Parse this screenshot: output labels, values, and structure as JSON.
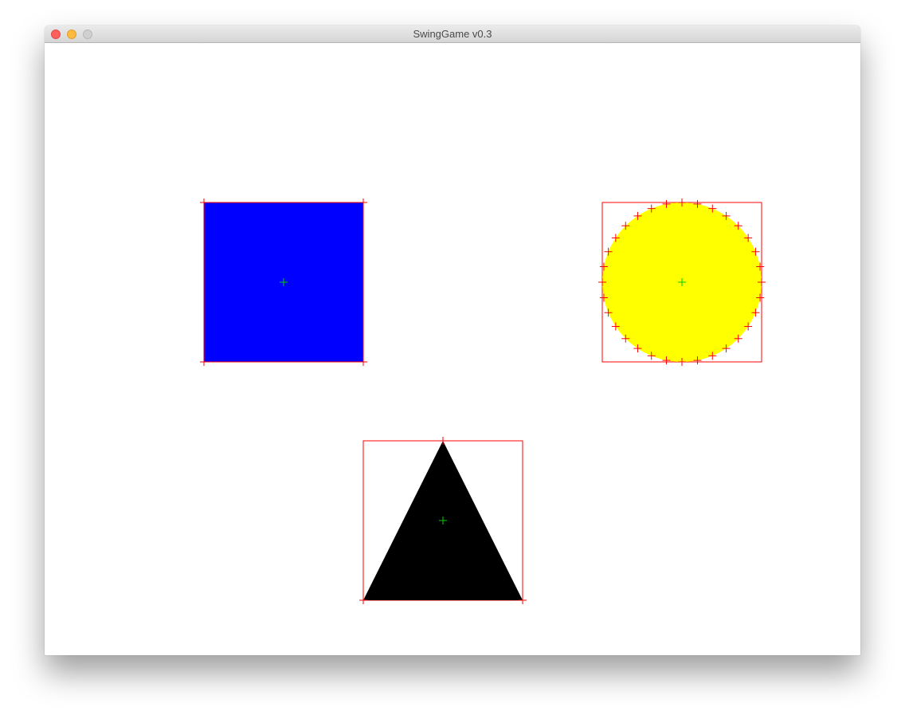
{
  "window": {
    "title": "SwingGame v0.3",
    "controls": [
      "close-icon",
      "minimize-icon",
      "zoom-icon"
    ]
  },
  "scene": {
    "background": "#ffffff",
    "shapes": [
      {
        "kind": "square",
        "fill": "#0000ff"
      },
      {
        "kind": "circle",
        "fill": "#ffff00"
      },
      {
        "kind": "triangle",
        "fill": "#000000"
      }
    ],
    "markers": {
      "bounds_color": "#ff0000",
      "center_color": "#00cc00",
      "marker_glyph": "plus"
    }
  }
}
